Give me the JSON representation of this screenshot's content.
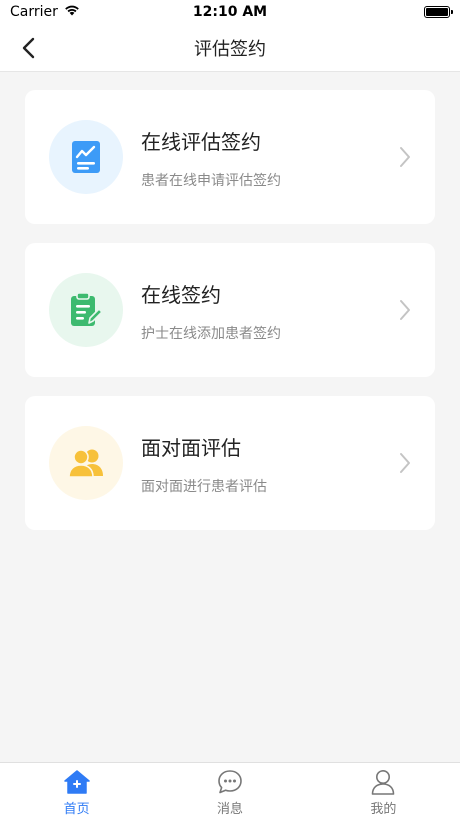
{
  "status_bar": {
    "carrier": "Carrier",
    "time": "12:10 AM"
  },
  "nav": {
    "title": "评估签约",
    "back_icon": "chevron-left-icon"
  },
  "cards": [
    {
      "title": "在线评估签约",
      "subtitle": "患者在线申请评估签约",
      "icon": "chart-document-icon",
      "icon_color": "#3d9bf7",
      "icon_bg": "#e8f4fe"
    },
    {
      "title": "在线签约",
      "subtitle": "护士在线添加患者签约",
      "icon": "clipboard-edit-icon",
      "icon_color": "#3dba6f",
      "icon_bg": "#e8f7ee"
    },
    {
      "title": "面对面评估",
      "subtitle": "面对面进行患者评估",
      "icon": "users-icon",
      "icon_color": "#f7c13a",
      "icon_bg": "#fef7e6"
    }
  ],
  "tabs": [
    {
      "label": "首页",
      "icon": "home-icon",
      "active": true
    },
    {
      "label": "消息",
      "icon": "chat-bubble-icon",
      "active": false
    },
    {
      "label": "我的",
      "icon": "user-icon",
      "active": false
    }
  ],
  "colors": {
    "accent": "#2f7bf5",
    "background": "#f5f5f5"
  }
}
